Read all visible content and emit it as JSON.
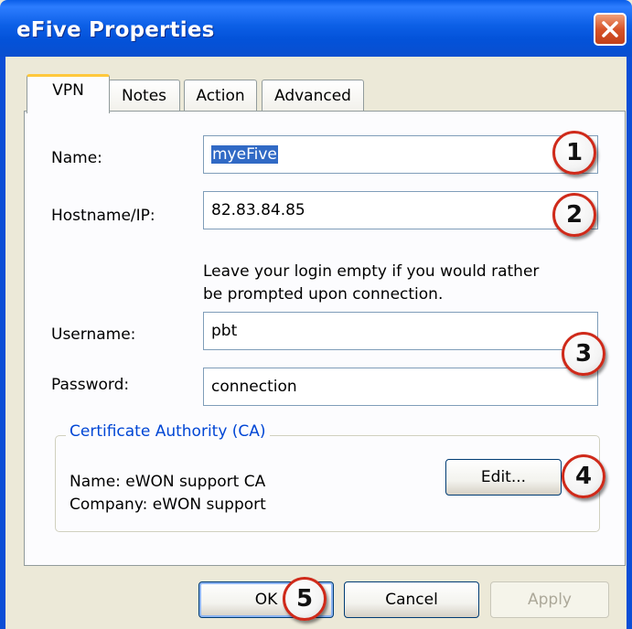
{
  "window": {
    "title": "eFive Properties"
  },
  "tabs": [
    {
      "label": "VPN",
      "active": true
    },
    {
      "label": "Notes",
      "active": false
    },
    {
      "label": "Action",
      "active": false
    },
    {
      "label": "Advanced",
      "active": false
    }
  ],
  "vpn": {
    "name_label": "Name:",
    "name_value": "myeFive",
    "hostname_label": "Hostname/IP:",
    "hostname_value": "82.83.84.85",
    "login_note_line1": "Leave your login empty if you would rather",
    "login_note_line2": "be prompted upon connection.",
    "username_label": "Username:",
    "username_value": "pbt",
    "password_label": "Password:",
    "password_value": "connection",
    "ca": {
      "group_title": "Certificate Authority (CA)",
      "name_line": "Name: eWON support CA",
      "company_line": "Company: eWON support",
      "edit_label": "Edit..."
    }
  },
  "buttons": {
    "ok": "OK",
    "cancel": "Cancel",
    "apply": "Apply"
  },
  "callouts": [
    "1",
    "2",
    "3",
    "4",
    "5"
  ],
  "colors": {
    "titlebar": "#0a5ee8",
    "selection": "#316ac5",
    "callout_border": "#cf2a1a",
    "group_title": "#0046d5"
  }
}
